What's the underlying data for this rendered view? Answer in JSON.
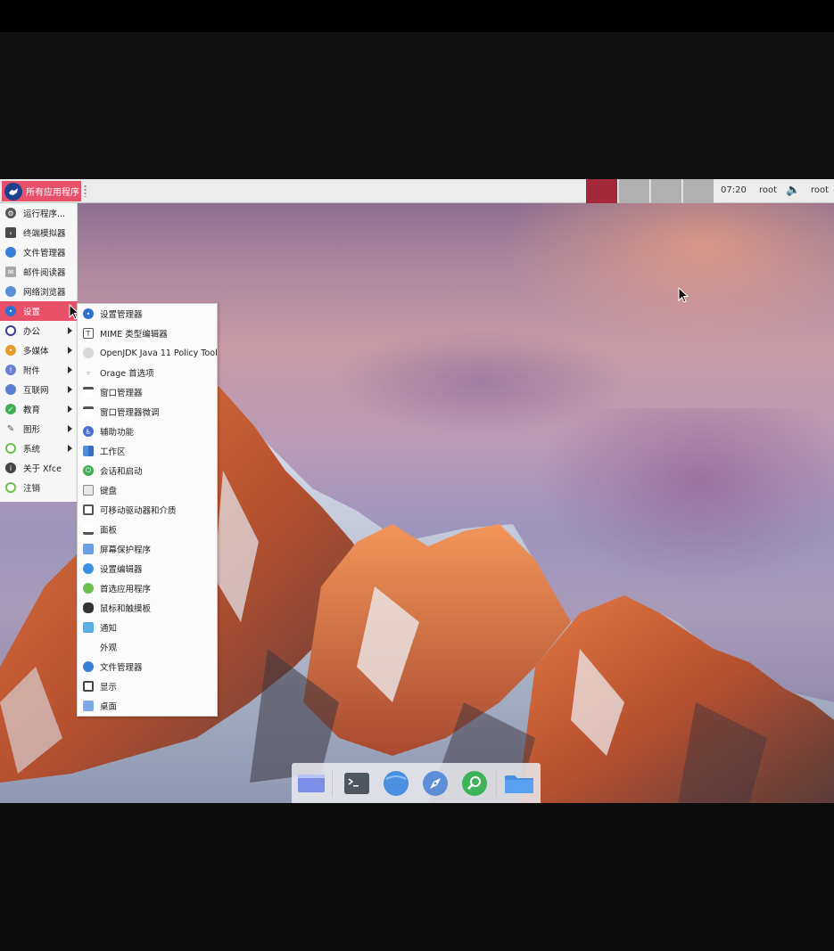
{
  "panel": {
    "apps_button_label": "所有应用程序",
    "clock": "07:20",
    "user_left": "root",
    "user_right": "root",
    "workspaces": [
      "1",
      "2",
      "3",
      "4"
    ],
    "active_workspace_color": "#a3283b"
  },
  "main_menu": {
    "items": [
      {
        "label": "运行程序...",
        "icon": "run-icon"
      },
      {
        "label": "终端模拟器",
        "icon": "terminal-icon"
      },
      {
        "label": "文件管理器",
        "icon": "file-manager-icon"
      },
      {
        "label": "邮件阅读器",
        "icon": "mail-icon"
      },
      {
        "label": "网络浏览器",
        "icon": "browser-icon"
      },
      {
        "label": "设置",
        "icon": "settings-icon",
        "submenu": true,
        "active": true
      },
      {
        "label": "办公",
        "icon": "office-icon",
        "submenu": true
      },
      {
        "label": "多媒体",
        "icon": "multimedia-icon",
        "submenu": true
      },
      {
        "label": "附件",
        "icon": "accessories-icon",
        "submenu": true
      },
      {
        "label": "互联网",
        "icon": "internet-icon",
        "submenu": true
      },
      {
        "label": "教育",
        "icon": "education-icon",
        "submenu": true
      },
      {
        "label": "图形",
        "icon": "graphics-icon",
        "submenu": true
      },
      {
        "label": "系统",
        "icon": "system-icon",
        "submenu": true
      },
      {
        "label": "关于 Xfce",
        "icon": "info-icon"
      },
      {
        "label": "注销",
        "icon": "logout-icon"
      }
    ]
  },
  "settings_submenu": {
    "items": [
      {
        "label": "设置管理器",
        "icon": "settings-manager-icon"
      },
      {
        "label": "MIME 类型编辑器",
        "icon": "mime-editor-icon"
      },
      {
        "label": "OpenJDK Java 11 Policy Tool",
        "icon": "java-icon"
      },
      {
        "label": "Orage 首选项",
        "icon": "orage-icon"
      },
      {
        "label": "窗口管理器",
        "icon": "window-manager-icon"
      },
      {
        "label": "窗口管理器微调",
        "icon": "window-tweaks-icon"
      },
      {
        "label": "辅助功能",
        "icon": "accessibility-icon"
      },
      {
        "label": "工作区",
        "icon": "workspaces-icon"
      },
      {
        "label": "会话和启动",
        "icon": "session-icon"
      },
      {
        "label": "键盘",
        "icon": "keyboard-icon"
      },
      {
        "label": "可移动驱动器和介质",
        "icon": "removable-drives-icon"
      },
      {
        "label": "面板",
        "icon": "panel-icon"
      },
      {
        "label": "屏幕保护程序",
        "icon": "screensaver-icon"
      },
      {
        "label": "设置编辑器",
        "icon": "settings-editor-icon"
      },
      {
        "label": "首选应用程序",
        "icon": "preferred-apps-icon"
      },
      {
        "label": "鼠标和触摸板",
        "icon": "mouse-icon"
      },
      {
        "label": "通知",
        "icon": "notifications-icon"
      },
      {
        "label": "外观",
        "icon": "appearance-icon"
      },
      {
        "label": "文件管理器",
        "icon": "file-manager-icon"
      },
      {
        "label": "显示",
        "icon": "display-icon"
      },
      {
        "label": "桌面",
        "icon": "desktop-icon"
      }
    ]
  },
  "dock": {
    "items": [
      {
        "icon": "desktop-icon"
      },
      {
        "icon": "terminal-icon"
      },
      {
        "icon": "file-manager-icon"
      },
      {
        "icon": "browser-icon"
      },
      {
        "icon": "search-icon"
      },
      {
        "icon": "folder-icon"
      }
    ]
  },
  "colors": {
    "accent": "#e8506a",
    "panel_bg": "#ececec",
    "menu_bg": "#f7f7f7"
  }
}
